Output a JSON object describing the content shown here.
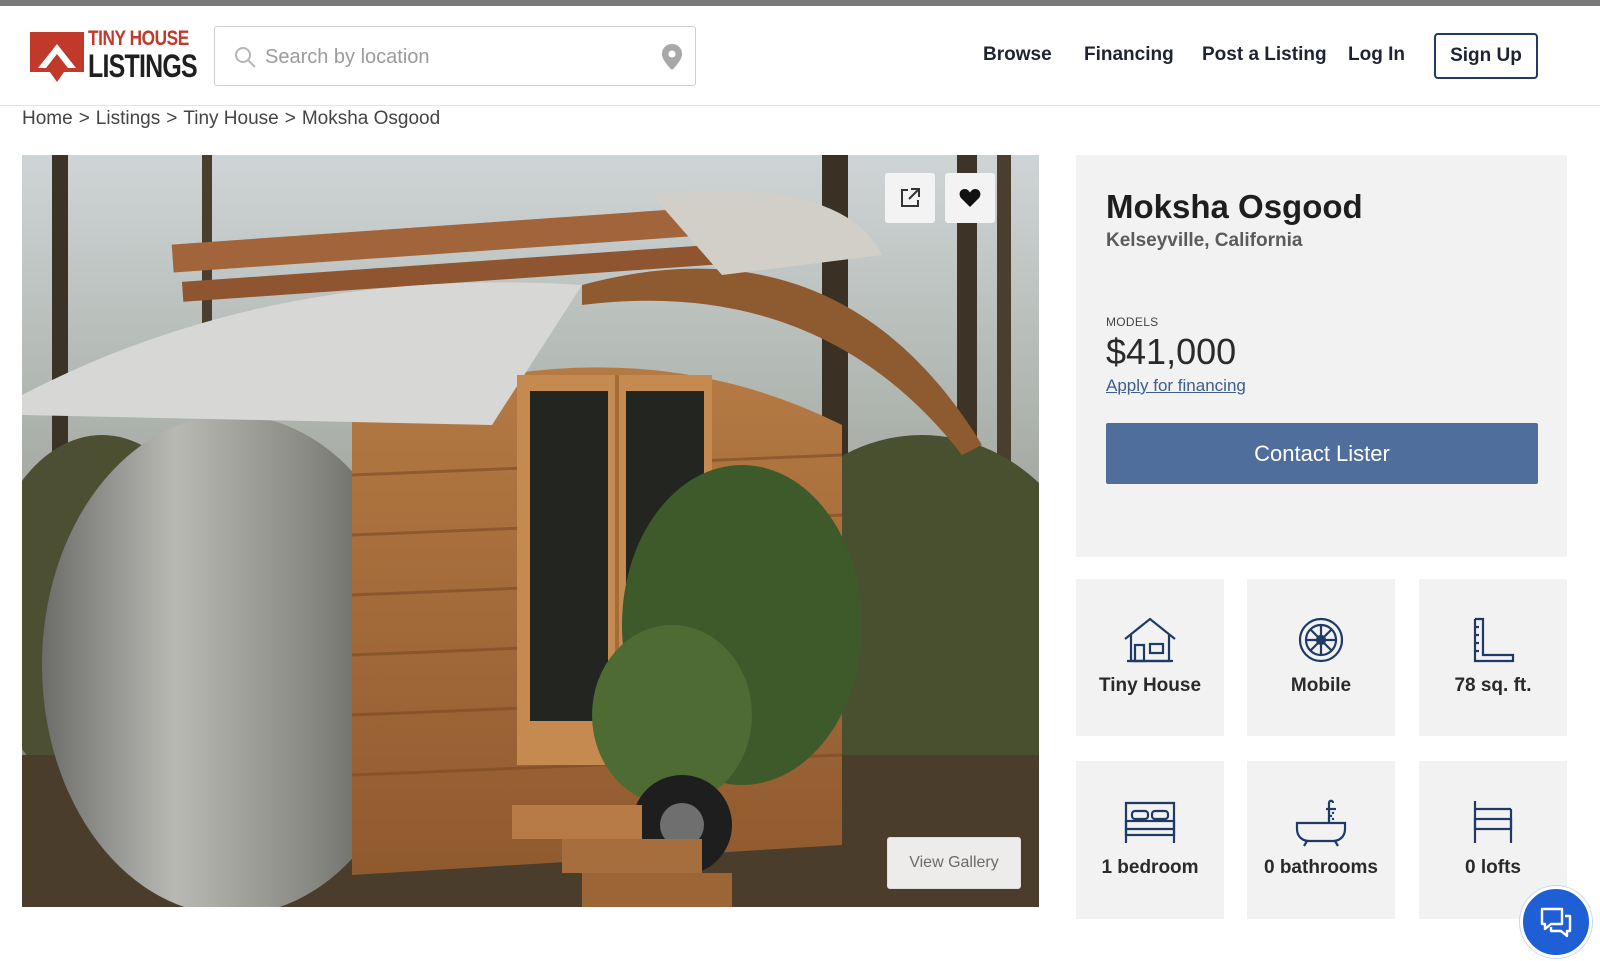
{
  "brand": {
    "line1": "TINY HOUSE",
    "line2": "LISTINGS"
  },
  "search": {
    "placeholder": "Search by location",
    "value": ""
  },
  "nav": {
    "browse": "Browse",
    "financing": "Financing",
    "post_listing": "Post a Listing",
    "login": "Log In",
    "signup": "Sign Up"
  },
  "breadcrumb": [
    "Home",
    "Listings",
    "Tiny House",
    "Moksha Osgood"
  ],
  "gallery": {
    "view_label": "View Gallery"
  },
  "listing": {
    "title": "Moksha Osgood",
    "location": "Kelseyville, California",
    "models_label": "MODELS",
    "price": "$41,000",
    "financing_link": "Apply for financing",
    "contact_button": "Contact Lister"
  },
  "features": [
    {
      "icon": "house-icon",
      "label": "Tiny House"
    },
    {
      "icon": "wheel-icon",
      "label": "Mobile"
    },
    {
      "icon": "ruler-icon",
      "label": "78 sq. ft."
    },
    {
      "icon": "bed-icon",
      "label": "1 bedroom"
    },
    {
      "icon": "bathtub-icon",
      "label": "0 bathrooms"
    },
    {
      "icon": "loft-bed-icon",
      "label": "0 lofts"
    }
  ],
  "colors": {
    "brand_red": "#c0392b",
    "accent_blue": "#4f6e9b",
    "link_blue": "#3d5e8e",
    "icon_navy": "#1f3a66",
    "chat_blue": "#1f5fd6"
  }
}
